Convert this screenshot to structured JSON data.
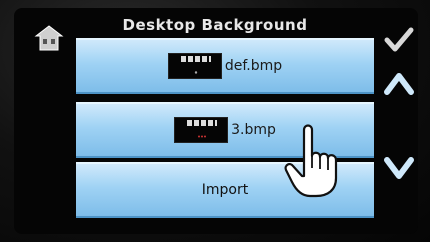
{
  "header": {
    "title": "Desktop Background"
  },
  "icons": {
    "home": "home-icon",
    "confirm": "checkmark-icon",
    "up": "chevron-up-icon",
    "down": "chevron-down-icon",
    "cursor": "pointing-hand-icon"
  },
  "list": {
    "items": [
      {
        "label": "def.bmp"
      },
      {
        "label": "3.bmp"
      },
      {
        "label": "Import"
      }
    ]
  },
  "colors": {
    "accent": "#8fc8f0",
    "background": "#050505",
    "text": "#e8e8e8"
  }
}
